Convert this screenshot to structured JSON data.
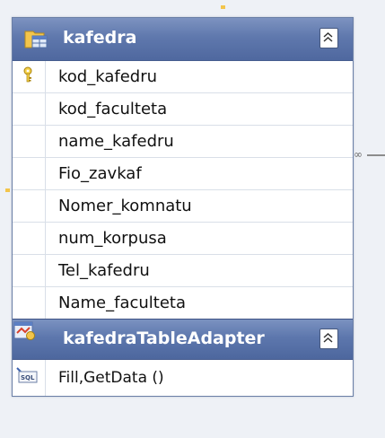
{
  "table": {
    "title": "kafedra",
    "columns": [
      {
        "name": "kod_kafedru",
        "primary_key": true
      },
      {
        "name": "kod_faculteta",
        "primary_key": false
      },
      {
        "name": "name_kafedru",
        "primary_key": false
      },
      {
        "name": "Fio_zavkaf",
        "primary_key": false
      },
      {
        "name": "Nomer_komnatu",
        "primary_key": false
      },
      {
        "name": "num_korpusa",
        "primary_key": false
      },
      {
        "name": "Tel_kafedru",
        "primary_key": false
      },
      {
        "name": "Name_faculteta",
        "primary_key": false
      }
    ]
  },
  "adapter": {
    "title": "kafedraTableAdapter",
    "methods": [
      "Fill,GetData ()"
    ]
  },
  "relation": {
    "symbol": "∞"
  },
  "colors": {
    "header_blue": "#5f78ad",
    "canvas": "#eef1f6",
    "accent_yellow": "#f3c54b"
  }
}
